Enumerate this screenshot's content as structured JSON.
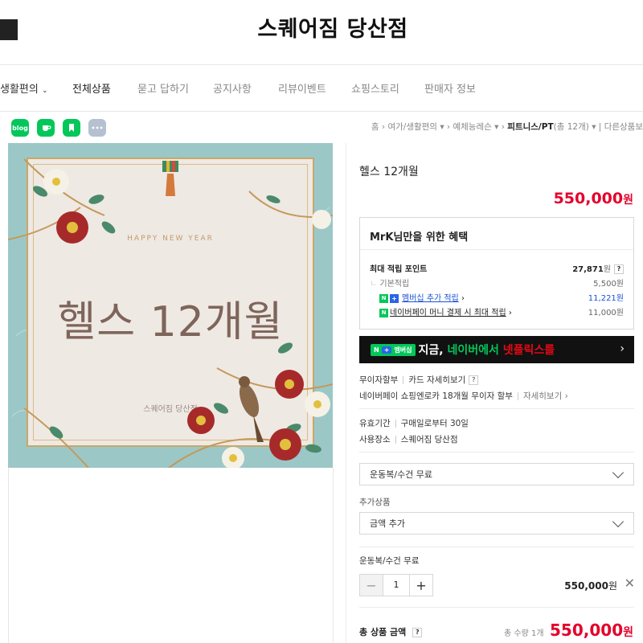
{
  "header": {
    "store_title": "스퀘어짐 당산점"
  },
  "nav": {
    "items": [
      "생활편의",
      "전체상품",
      "묻고 답하기",
      "공지사항",
      "리뷰이벤트",
      "쇼핑스토리",
      "판매자 정보"
    ]
  },
  "share_icons": [
    "blog-icon",
    "kakaotalk-icon",
    "bookmark-icon",
    "more-icon"
  ],
  "breadcrumb": {
    "home": "홈",
    "c1": "여가/생활편의",
    "c2": "예체능레슨",
    "c3": "피트니스/PT",
    "c3_count": "(총 12개)",
    "other": "다른상품보"
  },
  "image": {
    "greeting": "HAPPY NEW YEAR",
    "main_text": "헬스 12개월",
    "store": "스퀘어짐 당산점"
  },
  "product": {
    "name": "헬스 12개월",
    "price": "550,000",
    "price_unit": "원"
  },
  "benefits": {
    "title": "MrK님만을 위한 혜택",
    "max_points_label": "최대 적립 포인트",
    "max_points_value": "27,871",
    "max_points_unit": "원",
    "basic_label": "기본적립",
    "basic_value": "5,500원",
    "membership_label": "멤버십 추가 적립",
    "membership_value": "11,221원",
    "naverpay_label": "네이버페이 머니 결제 시 최대 적립",
    "naverpay_value": "11,000원"
  },
  "banner": {
    "badge": "멤버십",
    "text_prefix": "지금, ",
    "text_green": "네이버에서 ",
    "text_red": "넷플릭스를",
    "chevron": "›"
  },
  "installment": {
    "label": "무이자할부",
    "link": "카드 자세히보기",
    "naverpay_text": "네이버페이 쇼핑엔로카 18개월 무이자 할부",
    "naverpay_link": "자세히보기"
  },
  "usage": {
    "period_label": "유효기간",
    "period_value": "구매일로부터 30일",
    "place_label": "사용장소",
    "place_value": "스퀘어짐 당산점"
  },
  "options": {
    "select1": "운동복/수건 무료",
    "extra_label": "추가상품",
    "select2": "금액 추가",
    "selected_name": "운동복/수건 무료",
    "quantity": "1",
    "selected_price": "550,000",
    "selected_unit": "원"
  },
  "total": {
    "label": "총 상품 금액",
    "qty_text": "총 수량 1개",
    "price": "550,000",
    "unit": "원"
  },
  "colors": {
    "price_red": "#e4002b",
    "naver_green": "#03c75a",
    "link_blue": "#1b52d7",
    "image_bg": "#9cc7c7"
  }
}
